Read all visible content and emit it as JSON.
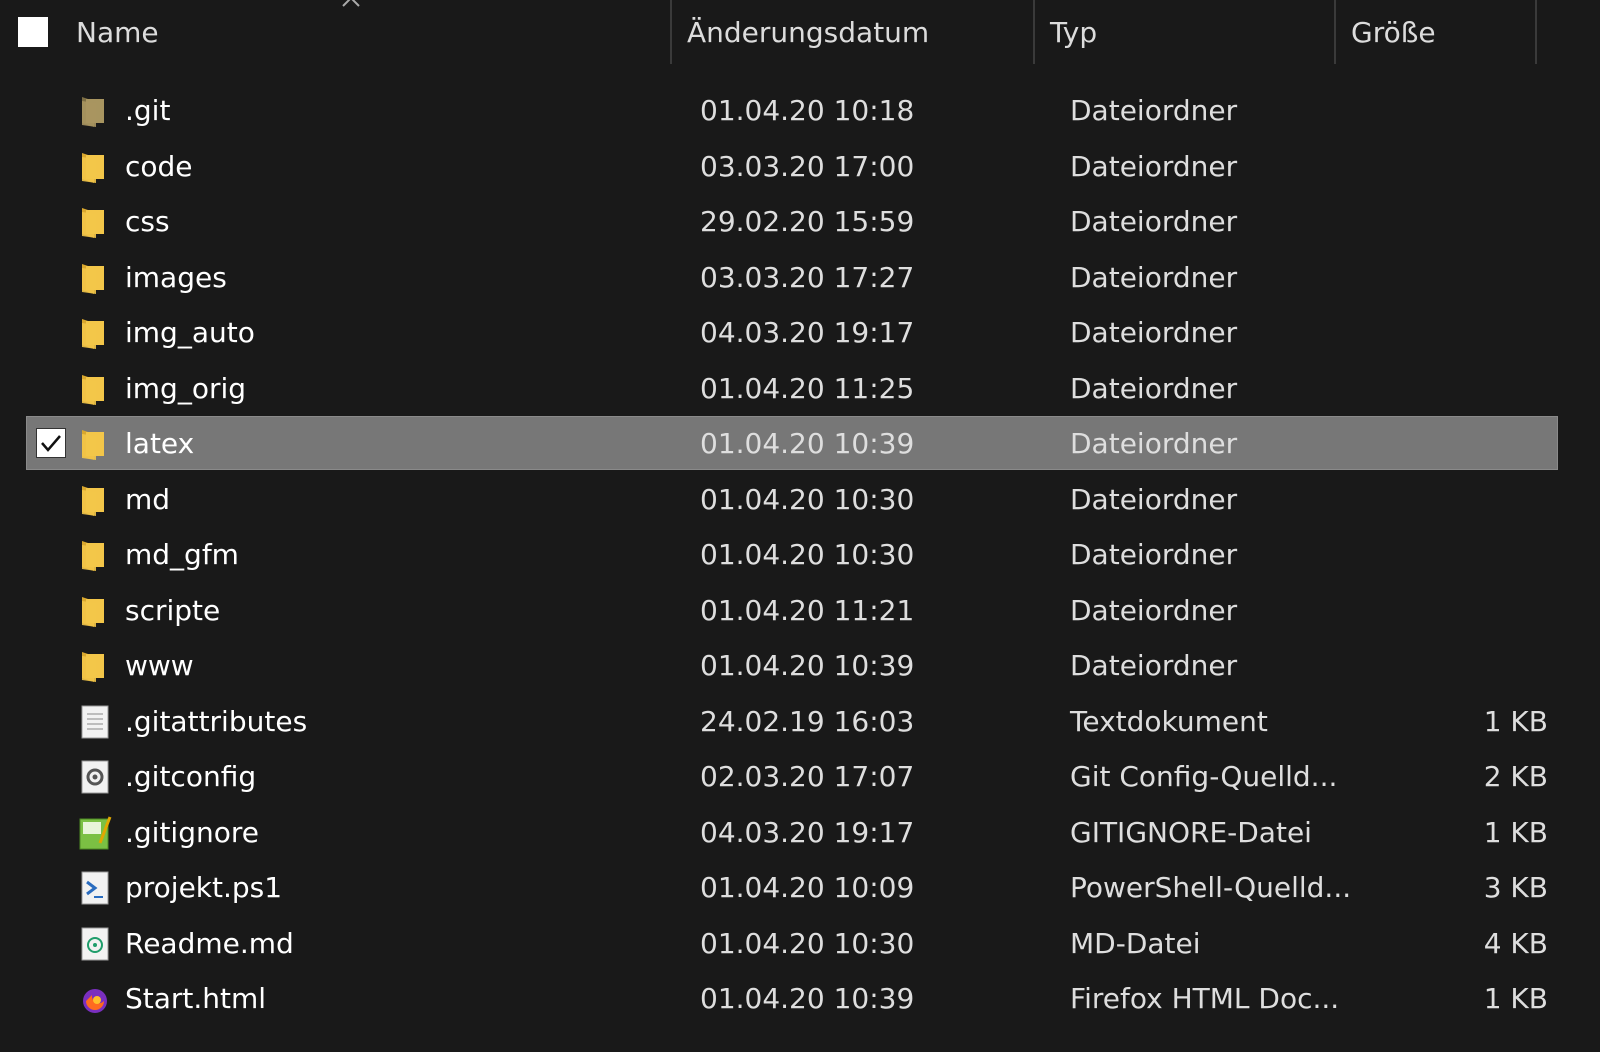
{
  "header": {
    "name": "Name",
    "date": "Änderungsdatum",
    "type": "Typ",
    "size": "Größe"
  },
  "rows": [
    {
      "name": ".git",
      "date": "01.04.20 10:18",
      "type": "Dateiordner",
      "size": "",
      "icon": "git-folder-icon"
    },
    {
      "name": "code",
      "date": "03.03.20 17:00",
      "type": "Dateiordner",
      "size": "",
      "icon": "folder-icon"
    },
    {
      "name": "css",
      "date": "29.02.20 15:59",
      "type": "Dateiordner",
      "size": "",
      "icon": "folder-icon"
    },
    {
      "name": "images",
      "date": "03.03.20 17:27",
      "type": "Dateiordner",
      "size": "",
      "icon": "folder-icon"
    },
    {
      "name": "img_auto",
      "date": "04.03.20 19:17",
      "type": "Dateiordner",
      "size": "",
      "icon": "folder-icon"
    },
    {
      "name": "img_orig",
      "date": "01.04.20 11:25",
      "type": "Dateiordner",
      "size": "",
      "icon": "folder-icon"
    },
    {
      "name": "latex",
      "date": "01.04.20 10:39",
      "type": "Dateiordner",
      "size": "",
      "icon": "folder-icon",
      "selected": true
    },
    {
      "name": "md",
      "date": "01.04.20 10:30",
      "type": "Dateiordner",
      "size": "",
      "icon": "folder-icon"
    },
    {
      "name": "md_gfm",
      "date": "01.04.20 10:30",
      "type": "Dateiordner",
      "size": "",
      "icon": "folder-icon"
    },
    {
      "name": "scripte",
      "date": "01.04.20 11:21",
      "type": "Dateiordner",
      "size": "",
      "icon": "folder-icon"
    },
    {
      "name": "www",
      "date": "01.04.20 10:39",
      "type": "Dateiordner",
      "size": "",
      "icon": "folder-icon"
    },
    {
      "name": ".gitattributes",
      "date": "24.02.19 16:03",
      "type": "Textdokument",
      "size": "1 KB",
      "icon": "text-file-icon"
    },
    {
      "name": ".gitconfig",
      "date": "02.03.20 17:07",
      "type": "Git Config-Quelld...",
      "size": "2 KB",
      "icon": "config-file-icon"
    },
    {
      "name": ".gitignore",
      "date": "04.03.20 19:17",
      "type": "GITIGNORE-Datei",
      "size": "1 KB",
      "icon": "gitignore-file-icon"
    },
    {
      "name": "projekt.ps1",
      "date": "01.04.20 10:09",
      "type": "PowerShell-Quelld...",
      "size": "3 KB",
      "icon": "powershell-file-icon"
    },
    {
      "name": "Readme.md",
      "date": "01.04.20 10:30",
      "type": "MD-Datei",
      "size": "4 KB",
      "icon": "markdown-file-icon"
    },
    {
      "name": "Start.html",
      "date": "01.04.20 10:39",
      "type": "Firefox HTML Doc...",
      "size": "1 KB",
      "icon": "firefox-html-icon"
    }
  ],
  "colors": {
    "background": "#191919",
    "selected_row": "#777777",
    "folder": "#f3c649",
    "git_folder": "#a89560"
  }
}
